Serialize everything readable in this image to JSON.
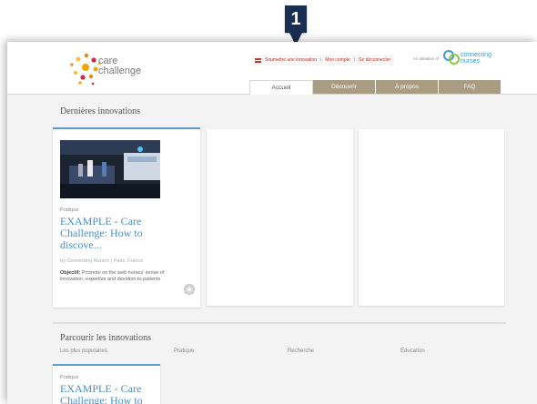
{
  "callout": {
    "number": "1"
  },
  "header": {
    "logo": {
      "line1": "care",
      "line2": "challenge"
    },
    "toplinks": {
      "submit": "Soumettre une innovation",
      "account": "Mon compte",
      "logout": "Se déconnecter"
    },
    "initiative_label": "An initiative of",
    "partner": {
      "line1": "connecting",
      "line2": "nurses"
    }
  },
  "nav": {
    "tabs": [
      {
        "label": "Accueil",
        "active": true
      },
      {
        "label": "Découvrir",
        "active": false
      },
      {
        "label": "À propos",
        "active": false
      },
      {
        "label": "FAQ",
        "active": false
      }
    ]
  },
  "latest": {
    "title": "Dernières innovations",
    "card": {
      "category": "Pratique",
      "title": "EXAMPLE - Care Challenge: How to discove...",
      "by": "by Connecting Nurses | Paris, France",
      "objective_label": "Objectif:",
      "objective_text": "Promote on the web nurses' sense of innovation, expertize and devotion to patients"
    }
  },
  "browse": {
    "title": "Parcourir les innovations",
    "filters": [
      "Les plus populaires",
      "Pratique",
      "Recherche",
      "Éducation"
    ],
    "card": {
      "category": "Pratique",
      "title": "EXAMPLE - Care Challenge: How to"
    }
  },
  "colors": {
    "accent": "#4a8fce",
    "nav_tab": "#a89d83",
    "callout": "#1a2e52"
  }
}
